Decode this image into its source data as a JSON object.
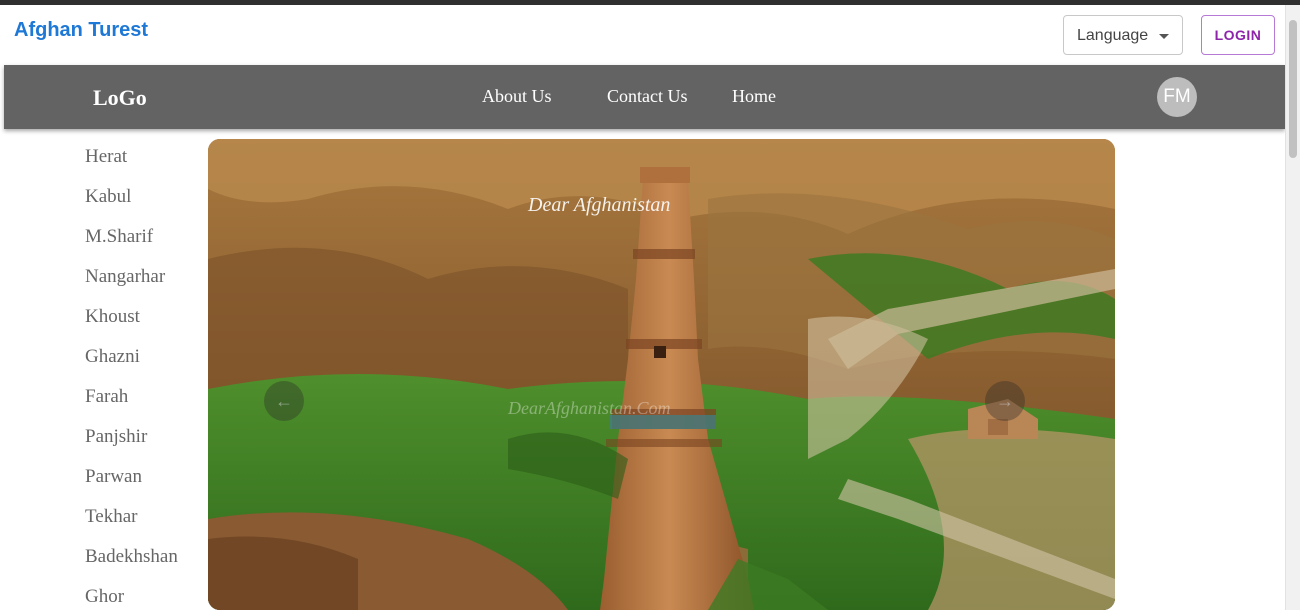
{
  "header": {
    "brand": "Afghan Turest",
    "language_label": "Language",
    "login_label": "LOGIN"
  },
  "navbar": {
    "logo": "LoGo",
    "links": [
      "About Us",
      "Contact Us",
      "Home"
    ],
    "avatar_initials": "FM"
  },
  "cities": [
    "Herat",
    "Kabul",
    "M.Sharif",
    "Nangarhar",
    "Khoust",
    "Ghazni",
    "Farah",
    "Panjshir",
    "Parwan",
    "Tekhar",
    "Badekhshan",
    "Ghor"
  ],
  "carousel": {
    "watermark_top": "Dear Afghanistan",
    "watermark_center": "DearAfghanistan.Com",
    "prev_icon": "arrow-left-icon",
    "next_icon": "arrow-right-icon"
  },
  "colors": {
    "brand": "#1e78d6",
    "navbar_bg": "#636363",
    "login_accent": "#8e24aa",
    "avatar_bg": "#bdbdbd"
  }
}
